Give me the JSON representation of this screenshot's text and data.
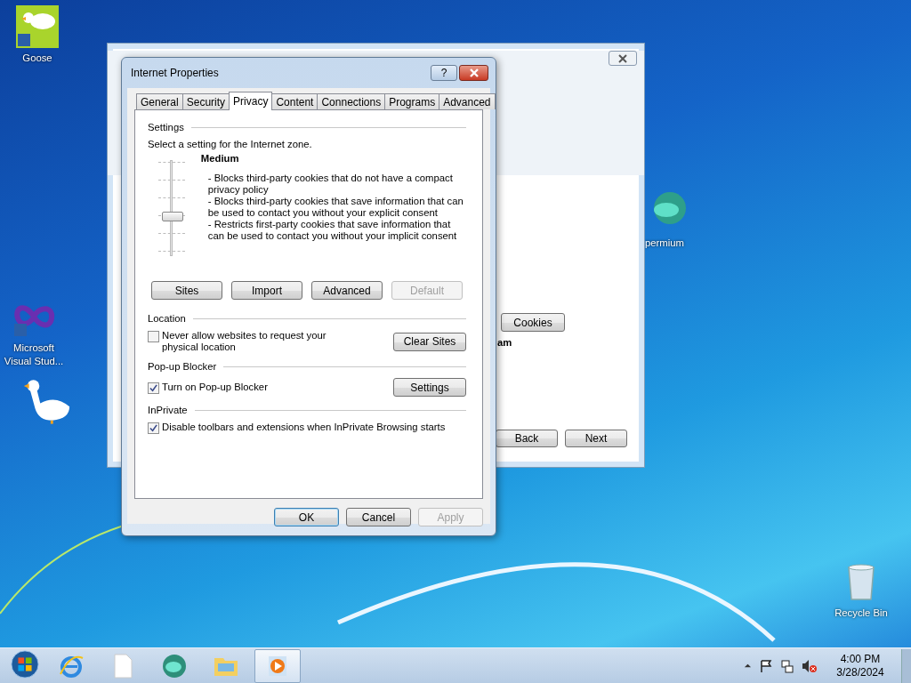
{
  "desktop_icons": [
    {
      "kind": "goose",
      "label": "Goose"
    },
    {
      "kind": "vs",
      "label": "Microsoft Visual Stud..."
    },
    {
      "kind": "app",
      "label": "permium"
    },
    {
      "kind": "bin",
      "label": "Recycle Bin"
    }
  ],
  "background_window": {
    "cookies_button": "Cookies",
    "bold_text": "am",
    "nav_buttons": [
      "Back",
      "Next"
    ]
  },
  "dialog": {
    "title": "Internet Properties",
    "help": "?",
    "tabs": [
      {
        "label": "General",
        "selected": false
      },
      {
        "label": "Security",
        "selected": false
      },
      {
        "label": "Privacy",
        "selected": true
      },
      {
        "label": "Content",
        "selected": false
      },
      {
        "label": "Connections",
        "selected": false
      },
      {
        "label": "Programs",
        "selected": false
      },
      {
        "label": "Advanced",
        "selected": false
      }
    ],
    "settings": {
      "heading": "Settings",
      "intro": "Select a setting for the Internet zone.",
      "level_name": "Medium",
      "level": 0.4,
      "description": [
        "- Blocks third-party cookies that do not have a compact privacy policy",
        "- Blocks third-party cookies that save information that can be used to contact you without your explicit consent",
        "- Restricts first-party cookies that save information that can be used to contact you without your implicit consent"
      ],
      "buttons": [
        {
          "label": "Sites",
          "disabled": false
        },
        {
          "label": "Import",
          "disabled": false
        },
        {
          "label": "Advanced",
          "disabled": false
        },
        {
          "label": "Default",
          "disabled": true
        }
      ]
    },
    "groups": [
      {
        "heading": "Location",
        "checkbox": "Never allow websites to request your physical location",
        "checked": false,
        "button": "Clear Sites"
      },
      {
        "heading": "Pop-up Blocker",
        "checkbox": "Turn on Pop-up Blocker",
        "checked": true,
        "button": "Settings"
      },
      {
        "heading": "InPrivate",
        "checkbox": "Disable toolbars and extensions when InPrivate Browsing starts",
        "checked": true
      }
    ],
    "footer_buttons": [
      {
        "label": "OK",
        "disabled": false,
        "default": true
      },
      {
        "label": "Cancel",
        "disabled": false,
        "default": false
      },
      {
        "label": "Apply",
        "disabled": true,
        "default": false
      }
    ]
  },
  "taskbar": {
    "items": [
      {
        "kind": "ie",
        "selected": false
      },
      {
        "kind": "file",
        "selected": false
      },
      {
        "kind": "app",
        "selected": false
      },
      {
        "kind": "folder",
        "selected": false
      },
      {
        "kind": "media",
        "selected": true
      }
    ],
    "time": "4:00 PM",
    "date": "3/28/2024"
  }
}
